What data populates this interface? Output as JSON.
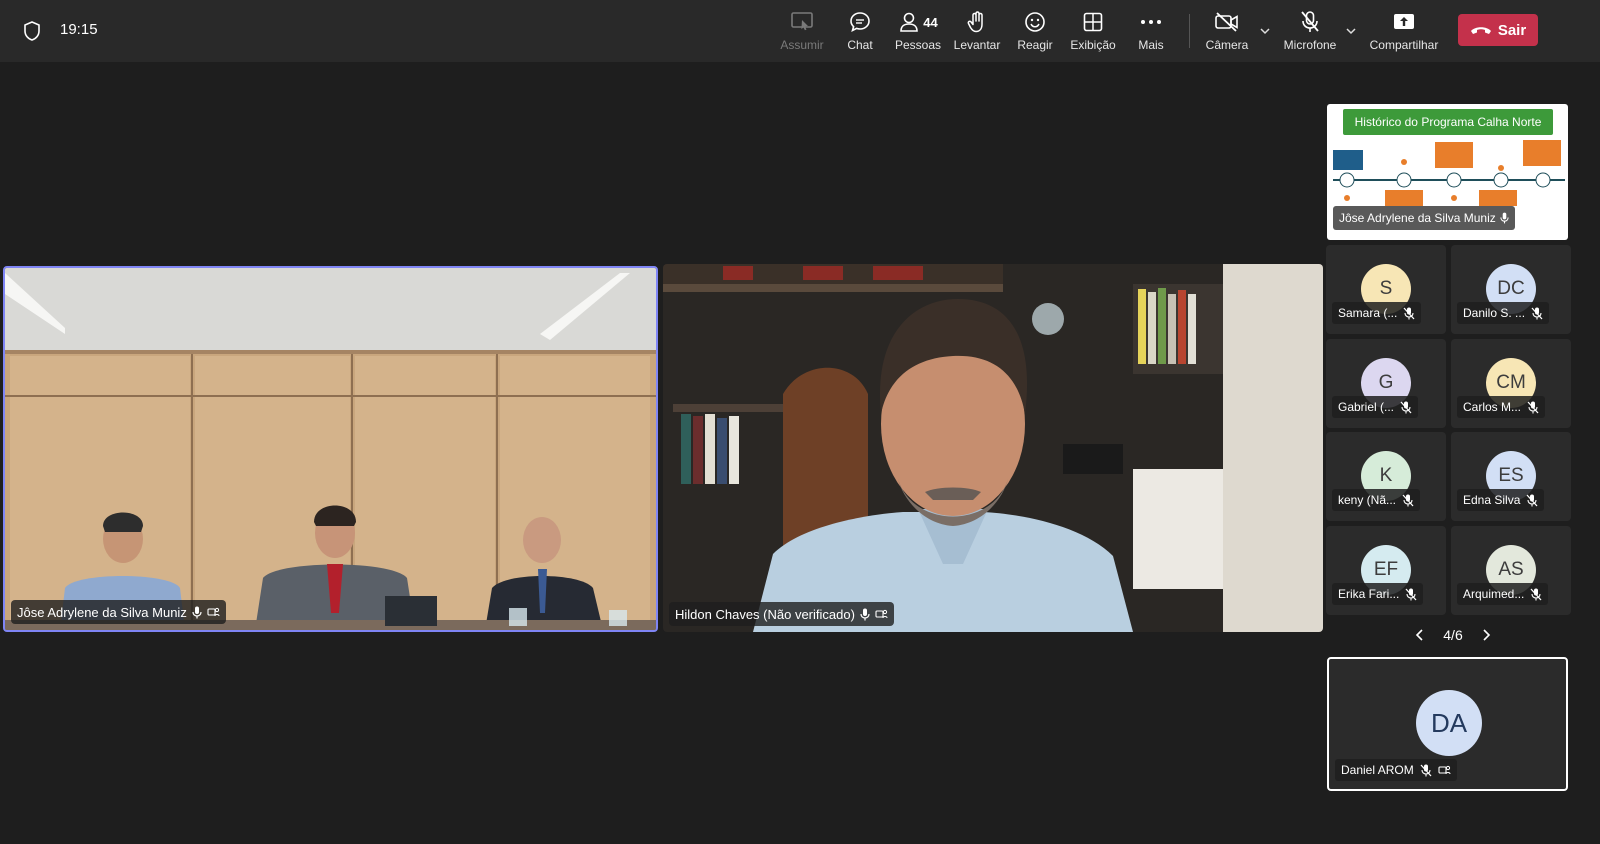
{
  "topbar": {
    "time": "19:15",
    "buttons": {
      "assumir": "Assumir",
      "chat": "Chat",
      "pessoas": "Pessoas",
      "pessoas_count": "44",
      "levantar": "Levantar",
      "reagir": "Reagir",
      "exibicao": "Exibição",
      "mais": "Mais",
      "camera": "Câmera",
      "microfone": "Microfone",
      "compartilhar": "Compartilhar",
      "sair": "Sair"
    }
  },
  "main_tiles": [
    {
      "name": "Jôse Adrylene da Silva Muniz"
    },
    {
      "name": "Hildon Chaves (Não verificado)"
    }
  ],
  "share": {
    "slide_title": "Histórico do Programa Calha Norte",
    "presenter": "Jôse Adrylene da Silva Muniz"
  },
  "participants": [
    {
      "initials": "S",
      "name": "Samara (...",
      "color": "#f7e6b5"
    },
    {
      "initials": "DC",
      "name": "Danilo S. ...",
      "color": "#d2dff5"
    },
    {
      "initials": "G",
      "name": "Gabriel (...",
      "color": "#dcd7f0"
    },
    {
      "initials": "CM",
      "name": "Carlos M...",
      "color": "#f7e6b5"
    },
    {
      "initials": "K",
      "name": "keny (Nã...",
      "color": "#d6ecd9"
    },
    {
      "initials": "ES",
      "name": "Edna Silva",
      "color": "#d2dff5"
    },
    {
      "initials": "EF",
      "name": "Erika Fari...",
      "color": "#d5ebf0"
    },
    {
      "initials": "AS",
      "name": "Arquimed...",
      "color": "#e3e8dc"
    }
  ],
  "pager": {
    "label": "4/6"
  },
  "self": {
    "initials": "DA",
    "name": "Daniel AROM"
  }
}
